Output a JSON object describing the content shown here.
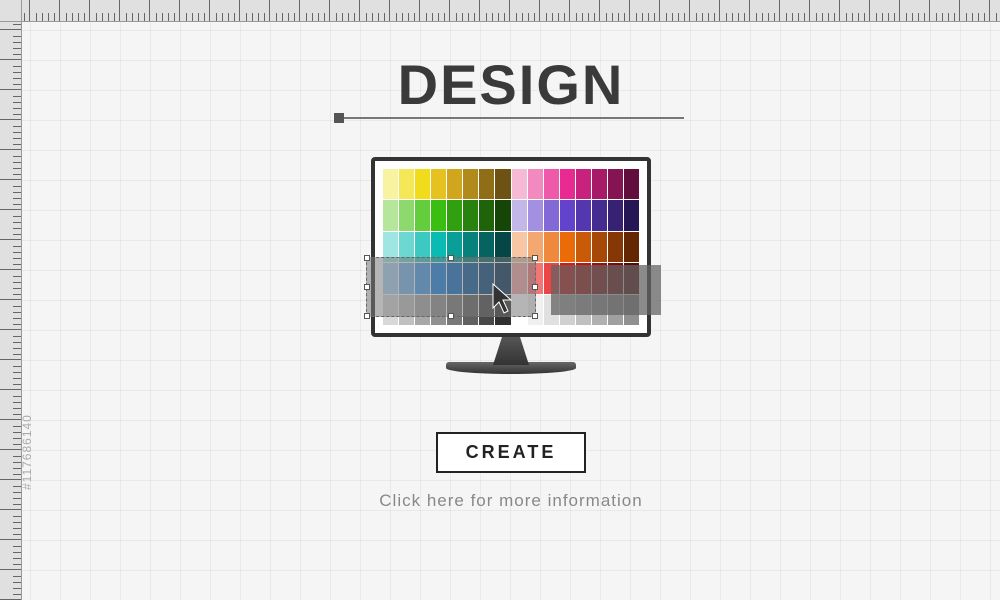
{
  "title": "DESIGN",
  "button_label": "CREATE",
  "info_text": "Click here for more information",
  "watermark": "#117686140",
  "colors": {
    "text_dark": "#3a3a3a",
    "button_border": "#222222",
    "info_gray": "#888888"
  },
  "swatch_palette": [
    "#f8f3a0",
    "#f4e858",
    "#f1dc1c",
    "#e6c220",
    "#cfa61e",
    "#b08a1b",
    "#8f6e17",
    "#6d5213",
    "#f6b9d6",
    "#f28ac0",
    "#ee5aa9",
    "#e82a92",
    "#c9217e",
    "#a61a68",
    "#841452",
    "#620e3d",
    "#b6e59c",
    "#8dd96d",
    "#63cd3e",
    "#3abe12",
    "#31a010",
    "#28820d",
    "#1f640a",
    "#164607",
    "#c3b7ea",
    "#a390e0",
    "#8369d6",
    "#6342cc",
    "#5437ae",
    "#452c90",
    "#362172",
    "#271654",
    "#9fe5e1",
    "#6dd7d1",
    "#3bc9c1",
    "#0abbb1",
    "#099e96",
    "#07817b",
    "#066460",
    "#044745",
    "#f7c7a5",
    "#f3a871",
    "#ef893d",
    "#eb6b09",
    "#c95a08",
    "#a74906",
    "#853805",
    "#632704",
    "#a9d2f4",
    "#78b7ee",
    "#479ce8",
    "#1781e2",
    "#136dc0",
    "#0f599e",
    "#0b457c",
    "#07315a",
    "#f6a7a7",
    "#f17676",
    "#ec4545",
    "#e71414",
    "#c41111",
    "#a10e0e",
    "#7e0b0b",
    "#5b0808",
    "#d8d8d8",
    "#c0c0c0",
    "#a8a8a8",
    "#909090",
    "#787878",
    "#606060",
    "#484848",
    "#303030",
    "#ffffff",
    "#f0f0f0",
    "#e0e0e0",
    "#d0d0d0",
    "#c0c0c0",
    "#b0b0b0",
    "#a0a0a0",
    "#909090"
  ]
}
